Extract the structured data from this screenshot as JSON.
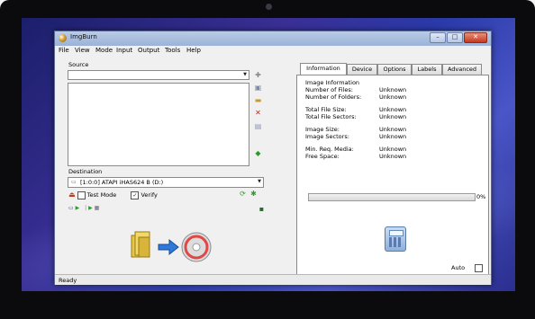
{
  "window": {
    "title": "ImgBurn"
  },
  "menu": [
    "File",
    "View",
    "Mode",
    "Input",
    "Output",
    "Tools",
    "Help"
  ],
  "source": {
    "label": "Source"
  },
  "destination": {
    "label": "Destination",
    "drive": "[1:0:0] ATAPI iHAS624   B (D:)"
  },
  "options": {
    "test_mode_label": "Test Mode",
    "test_mode_checked": false,
    "verify_label": "Verify",
    "verify_checked": true
  },
  "tabs": [
    "Information",
    "Device",
    "Options",
    "Labels",
    "Advanced"
  ],
  "active_tab": "Information",
  "info": {
    "heading": "Image Information",
    "rows": [
      {
        "label": "Number of Files:",
        "value": "Unknown"
      },
      {
        "label": "Number of Folders:",
        "value": "Unknown"
      },
      {
        "label": "Total File Size:",
        "value": "Unknown"
      },
      {
        "label": "Total File Sectors:",
        "value": "Unknown"
      },
      {
        "label": "Image Size:",
        "value": "Unknown"
      },
      {
        "label": "Image Sectors:",
        "value": "Unknown"
      },
      {
        "label": "Min. Req. Media:",
        "value": "Unknown"
      },
      {
        "label": "Free Space:",
        "value": "Unknown"
      }
    ]
  },
  "progress": {
    "percent_label": "0%",
    "value": 0
  },
  "auto_label": "Auto",
  "status_text": "Ready",
  "icons": [
    "add-files-icon",
    "browse-folder-icon",
    "remove-icon",
    "calculator-icon",
    "folder-icon",
    "disc-icon"
  ],
  "colors": {
    "title_bar": "#9bb3d8",
    "desktop": "#3a2f95",
    "close_button": "#c4381f"
  }
}
